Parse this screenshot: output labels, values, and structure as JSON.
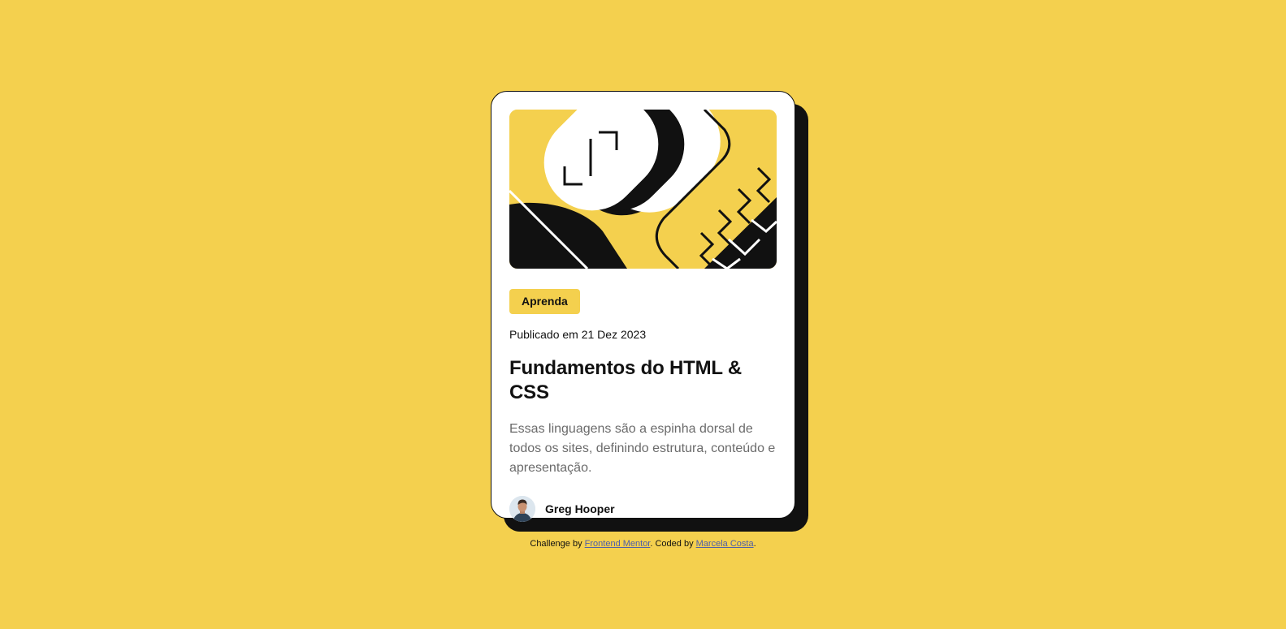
{
  "colors": {
    "background": "#F4D04E",
    "card": "#FFFFFF",
    "ink": "#111111",
    "muted_text": "#6B6B6B",
    "link": "#4F5FA8"
  },
  "card": {
    "hero_image": "abstract-illustration",
    "tag_label": "Aprenda",
    "published": "Publicado em 21 Dez 2023",
    "title": "Fundamentos do HTML & CSS",
    "description": "Essas linguagens são a espinha dorsal de todos os sites, definindo estrutura, conteúdo e apresentação.",
    "author": {
      "avatar_icon": "author-avatar",
      "name": "Greg Hooper"
    }
  },
  "attribution": {
    "prefix": "Challenge by",
    "challenge_link": "Frontend Mentor",
    "middle": ". Coded by",
    "author_link": "Marcela Costa",
    "suffix": "."
  }
}
